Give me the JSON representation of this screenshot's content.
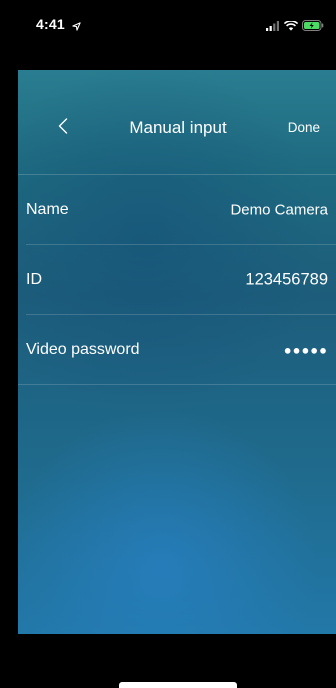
{
  "status_bar": {
    "time": "4:41",
    "icons": [
      "location-arrow-icon",
      "signal-icon",
      "wifi-icon",
      "battery-charging-icon"
    ],
    "battery_color": "#4cd964"
  },
  "nav": {
    "back_icon": "chevron-left-icon",
    "title": "Manual input",
    "done_label": "Done"
  },
  "fields": {
    "name": {
      "label": "Name",
      "value": "Demo Camera"
    },
    "id": {
      "label": "ID",
      "value": "123456789"
    },
    "password": {
      "label": "Video password",
      "value": "●●●●●"
    }
  }
}
